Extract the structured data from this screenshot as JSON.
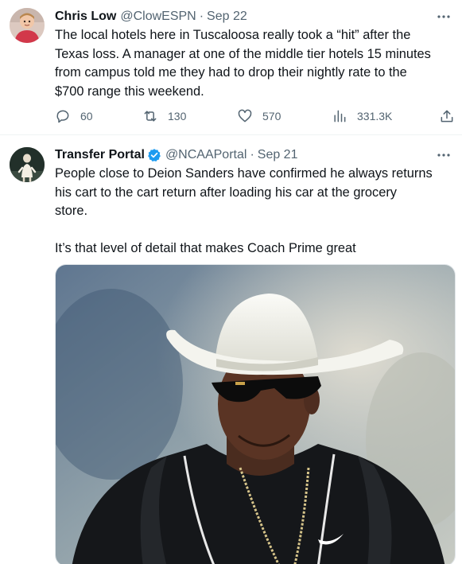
{
  "tweets": [
    {
      "display_name": "Chris Low",
      "handle": "@ClowESPN",
      "separator": "·",
      "date": "Sep 22",
      "text": "The local hotels here in Tuscaloosa really took a “hit” after the\nTexas loss. A manager at one of the middle tier hotels 15 minutes\nfrom campus told me they had to drop their nightly rate to the\n$700 range this weekend.",
      "stats": {
        "replies": "60",
        "retweets": "130",
        "likes": "570",
        "views": "331.3K"
      },
      "icons": [
        "more-icon",
        "reply-icon",
        "retweet-icon",
        "like-icon",
        "views-icon",
        "share-icon"
      ]
    },
    {
      "display_name": "Transfer Portal",
      "handle": "@NCAAPortal",
      "separator": "·",
      "date": "Sep 21",
      "verified": true,
      "text": "People close to Deion Sanders have confirmed he always returns\nhis cart to the cart return after loading his car at the grocery\nstore.\n\nIt’s that level of detail that makes Coach Prime great",
      "icons": [
        "more-icon",
        "verified-badge-icon"
      ]
    }
  ],
  "colors": {
    "text": "#0f1419",
    "secondary": "#536471",
    "verified": "#1d9bf0",
    "divider": "#eff3f4"
  }
}
